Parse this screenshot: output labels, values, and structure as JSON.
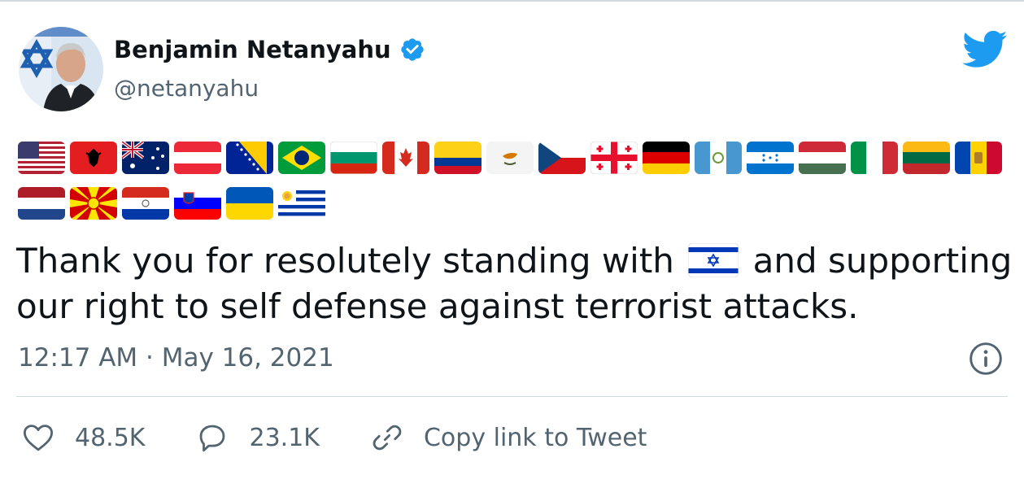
{
  "author": {
    "name": "Benjamin Netanyahu",
    "handle": "@netanyahu"
  },
  "icons": {
    "avatar": "profile-photo",
    "verified": "verified-badge-icon",
    "logo": "twitter-bird-icon",
    "info": "info-icon",
    "like": "heart-icon",
    "reply": "reply-icon",
    "link": "link-icon"
  },
  "flags": {
    "row1": [
      "us",
      "albania",
      "australia",
      "austria",
      "bosnia",
      "brazil",
      "bulgaria",
      "canada",
      "colombia",
      "cyprus",
      "czechia",
      "georgia",
      "germany",
      "guatemala",
      "honduras",
      "hungary",
      "italy",
      "lithuania",
      "moldova"
    ],
    "row2": [
      "netherlands",
      "north-macedonia",
      "paraguay",
      "slovenia",
      "ukraine",
      "uruguay"
    ]
  },
  "tweet": {
    "text_before": "Thank you for resolutely standing with",
    "inline_flag": "israel",
    "text_after": "and supporting our right to self defense against terrorist attacks.",
    "timestamp": "12:17 AM · May 16, 2021"
  },
  "actions": {
    "likes": "48.5K",
    "replies": "23.1K",
    "copy_link": "Copy link to Tweet"
  },
  "colors": {
    "text": "#0f1419",
    "secondary": "#536471",
    "twitter_blue": "#1d9bf0",
    "divider": "#cfd9de"
  }
}
